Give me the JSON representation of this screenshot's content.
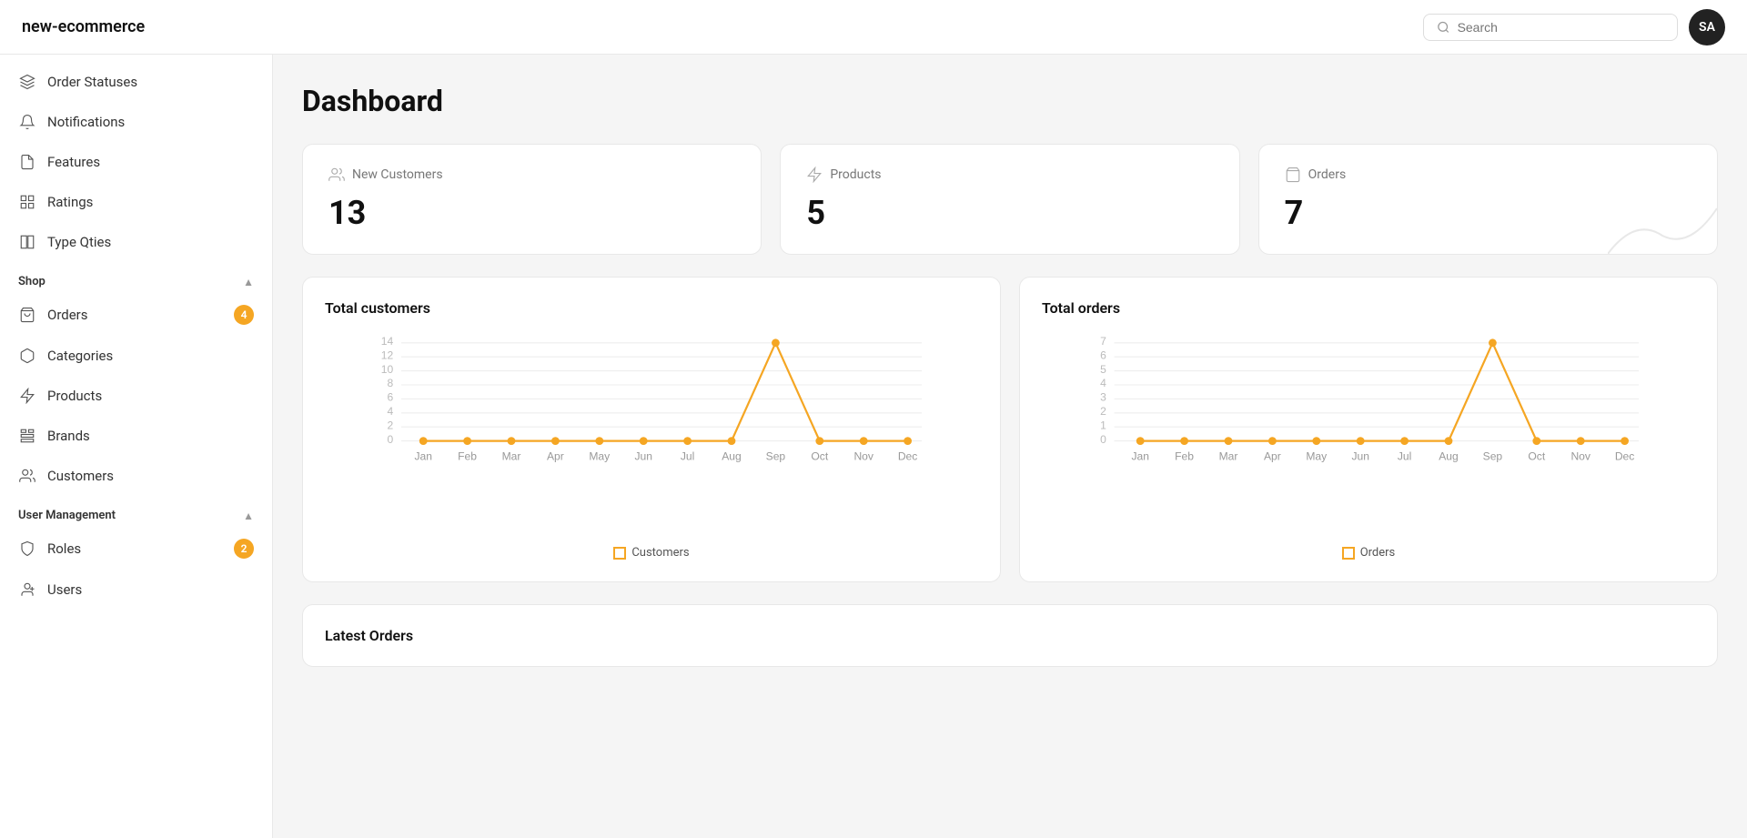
{
  "header": {
    "logo": "new-ecommerce",
    "search_placeholder": "Search",
    "avatar_initials": "SA"
  },
  "sidebar": {
    "top_items": [
      {
        "id": "order-statuses",
        "label": "Order Statuses",
        "icon": "layers"
      },
      {
        "id": "notifications",
        "label": "Notifications",
        "icon": "bell"
      },
      {
        "id": "features",
        "label": "Features",
        "icon": "file"
      },
      {
        "id": "ratings",
        "label": "Ratings",
        "icon": "grid"
      },
      {
        "id": "type-qties",
        "label": "Type Qties",
        "icon": "columns"
      }
    ],
    "shop_section": "Shop",
    "shop_items": [
      {
        "id": "orders",
        "label": "Orders",
        "icon": "bag",
        "badge": "4"
      },
      {
        "id": "categories",
        "label": "Categories",
        "icon": "box"
      },
      {
        "id": "products",
        "label": "Products",
        "icon": "lightning"
      },
      {
        "id": "brands",
        "label": "Brands",
        "icon": "grid2"
      },
      {
        "id": "customers",
        "label": "Customers",
        "icon": "users"
      }
    ],
    "user_management_section": "User Management",
    "user_items": [
      {
        "id": "roles",
        "label": "Roles",
        "icon": "shield",
        "badge": "2"
      },
      {
        "id": "users",
        "label": "Users",
        "icon": "user-plus"
      }
    ]
  },
  "dashboard": {
    "title": "Dashboard",
    "stats": [
      {
        "id": "new-customers",
        "label": "New Customers",
        "value": "13",
        "icon": "users-icon"
      },
      {
        "id": "products",
        "label": "Products",
        "value": "5",
        "icon": "lightning-icon"
      },
      {
        "id": "orders",
        "label": "Orders",
        "value": "7",
        "icon": "bag-icon"
      }
    ],
    "total_customers_title": "Total customers",
    "total_orders_title": "Total orders",
    "customers_legend": "Customers",
    "orders_legend": "Orders",
    "customers_data": [
      0,
      0,
      0,
      0,
      0,
      0,
      0,
      0,
      13,
      0,
      0,
      0
    ],
    "orders_data": [
      0,
      0,
      0,
      0,
      0,
      0,
      0,
      0,
      7,
      0,
      0,
      0
    ],
    "months": [
      "Jan",
      "Feb",
      "Mar",
      "Apr",
      "May",
      "Jun",
      "Jul",
      "Aug",
      "Sep",
      "Oct",
      "Nov",
      "Dec"
    ],
    "latest_orders_title": "Latest Orders"
  }
}
